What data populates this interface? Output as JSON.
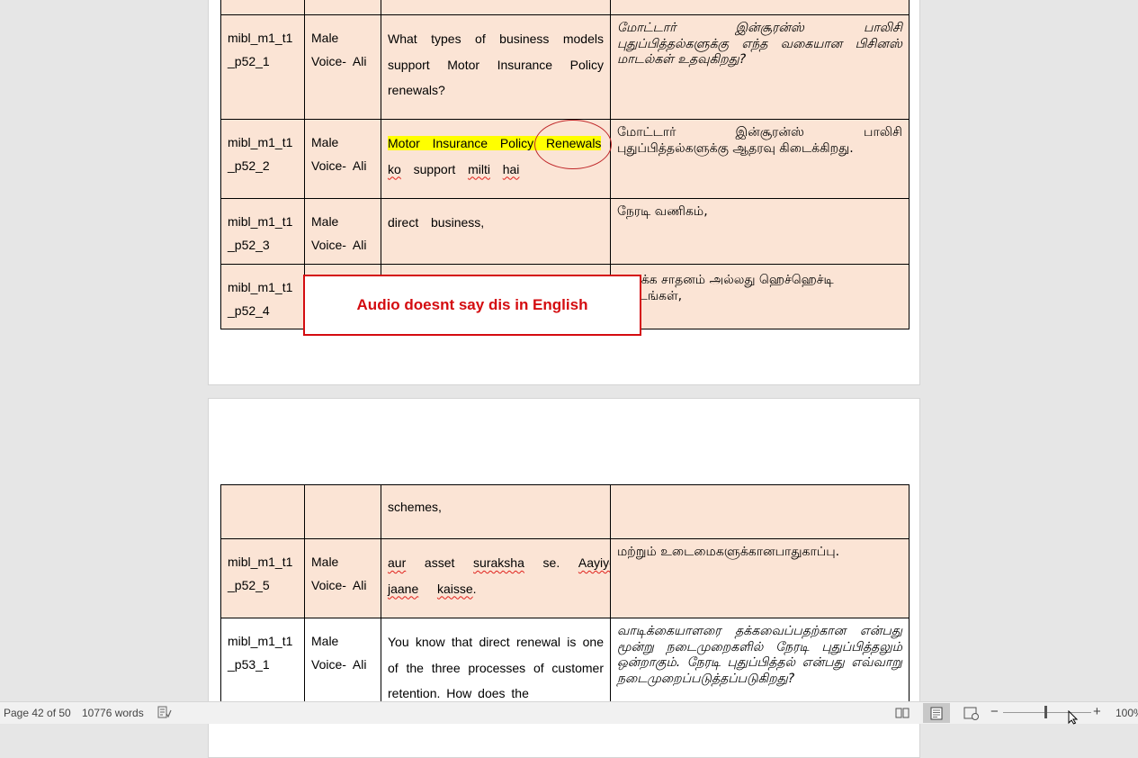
{
  "document": {
    "page1_rows": [
      {
        "id_a": "mibl_m1_t1",
        "id_b": "_p52_1",
        "speaker_a": "Male",
        "speaker_b": "Voice-  Ali",
        "english": "What types of business models support Motor Insurance Policy renewals?",
        "tamil": "மோட்டார் இன்சூரன்ஸ் பாலிசி புதுப்பித்தல்களுக்கு எந்த வகையான பிசினஸ் மாடல்கள் உதவுகிறது?"
      },
      {
        "id_a": "mibl_m1_t1",
        "id_b": "_p52_2",
        "speaker_a": "Male",
        "speaker_b": "Voice-  Ali",
        "english_highlight": "Motor  Insurance  Policy  Renewals",
        "english_w1": "ko",
        "english_w2": "support",
        "english_w3": "milti",
        "english_w4": "hai",
        "tamil": "மோட்டார் இன்சூரன்ஸ் பாலிசி புதுப்பித்தல்களுக்கு ஆதரவு கிடைக்கிறது."
      },
      {
        "id_a": "mibl_m1_t1",
        "id_b": "_p52_3",
        "speaker_a": "Male",
        "speaker_b": "Voice-  Ali",
        "english": "direct  business,",
        "tamil": "நேரடி வணிகம்,"
      },
      {
        "id_a": "mibl_m1_t1",
        "id_b": "_p52_4",
        "speaker_a": "",
        "speaker_b": "",
        "english": "",
        "tamil_line1": "முடக்க சாதனம் அல்லது ஹெச்ஹெச்டி",
        "tamil_line2": "திட்டங்கள்,"
      }
    ],
    "page2_rows": [
      {
        "id_a": "",
        "id_b": "",
        "speaker_a": "",
        "speaker_b": "",
        "english": "schemes,",
        "tamil": ""
      },
      {
        "id_a": "mibl_m1_t1",
        "id_b": "_p52_5",
        "speaker_a": "Male",
        "speaker_b": "Voice-  Ali",
        "english_w1": "aur",
        "english_w2": "asset",
        "english_w3": "suraksha",
        "english_w4": "se.",
        "english_w5": "Aayiye",
        "english_w6": "jaane",
        "english_w7": "kaisse",
        "tamil": "மற்றும் உடைமைகளுக்கானபாதுகாப்பு."
      },
      {
        "id_a": "mibl_m1_t1",
        "id_b": "_p53_1",
        "speaker_a": "Male",
        "speaker_b": "Voice-  Ali",
        "english": "You know that direct renewal is one of the three processes of customer retention. How does the",
        "tamil": "வாடிக்கையாளரை தக்கவைப்பதற்கான என்பது மூன்று நடைமுறைகளில் நேரடி புதுப்பித்தலும் ஒன்றாகும். நேரடி புதுப்பித்தல் என்பது எவ்வாறு நடைமுறைப்படுத்தப்படுகிறது?"
      }
    ],
    "annotation": {
      "callout_text": "Audio doesnt say dis in English"
    }
  },
  "status_bar": {
    "page_info": "Page 42 of 50",
    "word_count": "10776 words",
    "zoom_minus": "−",
    "zoom_plus": "+",
    "zoom_level": "100%"
  },
  "colors": {
    "row_fill": "#fbe4d5",
    "highlight": "#ffff00",
    "annotation_red": "#d40c10"
  }
}
